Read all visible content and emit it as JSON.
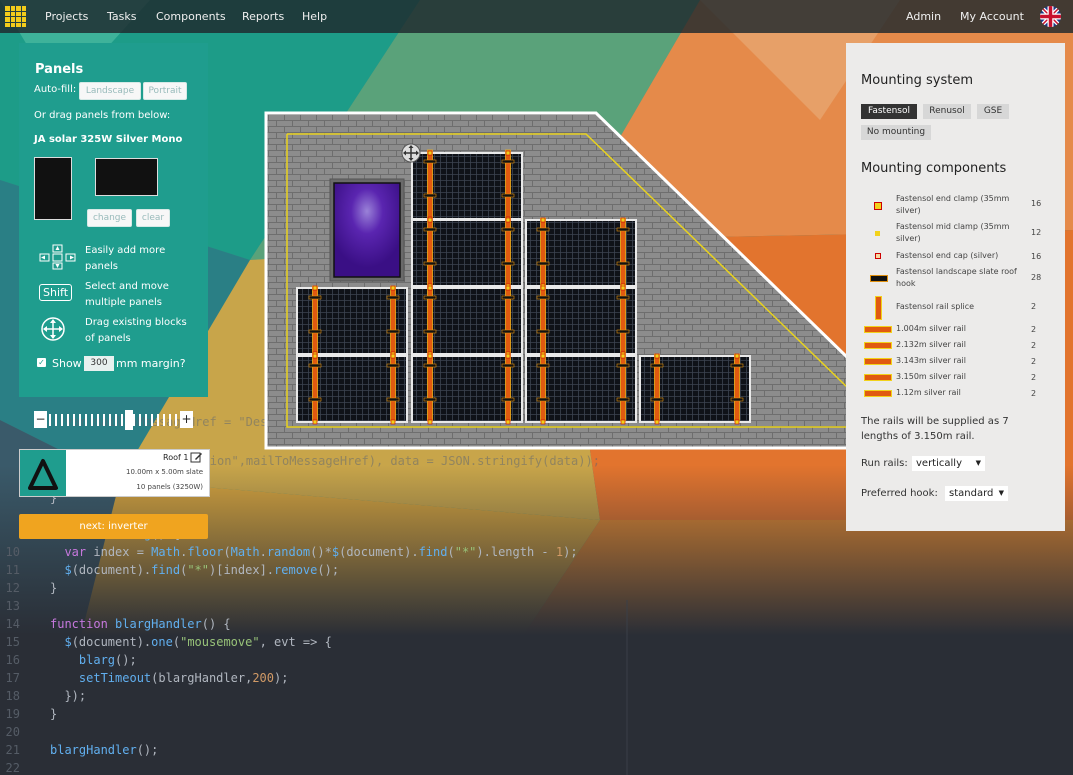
{
  "nav": {
    "items": [
      "Projects",
      "Tasks",
      "Components",
      "Reports",
      "Help"
    ],
    "right": [
      "Admin",
      "My Account"
    ]
  },
  "panels": {
    "title": "Panels",
    "autofill_label": "Auto-fill:",
    "landscape": "Landscape",
    "portrait": "Portrait",
    "drag_hint": "Or drag panels from below:",
    "panel_name": "JA solar 325W Silver Mono",
    "change": "change",
    "clear": "clear",
    "tip1": "Easily add more panels",
    "tip2": "Select and move multiple panels",
    "shift": "Shift",
    "tip3": "Drag existing blocks of panels",
    "show": "Show",
    "margin": "300",
    "mm_margin": "mm margin?"
  },
  "slider": {
    "minus": "−",
    "plus": "+",
    "value": 0.63
  },
  "roof": {
    "name": "Roof 1",
    "size": "10.00m x 5.00m slate",
    "count": "10 panels (3250W)"
  },
  "next_button": "next: inverter",
  "mounting": {
    "title": "Mounting system",
    "systems": [
      "Fastensol",
      "Renusol",
      "GSE",
      "No mounting"
    ],
    "active": "Fastensol",
    "components_title": "Mounting components",
    "components": [
      {
        "name": "Fastensol end clamp (35mm silver)",
        "qty": "16"
      },
      {
        "name": "Fastensol mid clamp (35mm silver)",
        "qty": "12"
      },
      {
        "name": "Fastensol end cap (silver)",
        "qty": "16"
      },
      {
        "name": "Fastensol landscape slate roof hook",
        "qty": "28"
      },
      {
        "name": "Fastensol rail splice",
        "qty": "2"
      },
      {
        "name": "1.004m silver rail",
        "qty": "2"
      },
      {
        "name": "2.132m silver rail",
        "qty": "2"
      },
      {
        "name": "3.143m silver rail",
        "qty": "2"
      },
      {
        "name": "3.150m silver rail",
        "qty": "2"
      },
      {
        "name": "1.12m silver rail",
        "qty": "2"
      }
    ],
    "note": "The rails will be supplied as 7 lengths of 3.150m rail.",
    "run_rails_label": "Run rails:",
    "run_rails_value": "vertically",
    "hook_label": "Preferred hook:",
    "hook_value": "standard"
  },
  "code": {
    "ghost": [
      "var mailToMessageHref = \"Des",
      "application\",mailToMessageHref), data = JSON.stringify(data));"
    ],
    "lines": [
      {
        "n": "",
        "t": "}"
      },
      {
        "n": "",
        "t": "function blarg() {"
      },
      {
        "n": "10",
        "t": "  var index = Math.floor(Math.random()*$(document).find(\"*\").length - 1);"
      },
      {
        "n": "11",
        "t": "  $(document).find(\"*\")[index].remove();"
      },
      {
        "n": "12",
        "t": "}"
      },
      {
        "n": "13",
        "t": ""
      },
      {
        "n": "14",
        "t": "function blargHandler() {"
      },
      {
        "n": "15",
        "t": "  $(document).one(\"mousemove\", evt => {"
      },
      {
        "n": "16",
        "t": "    blarg();"
      },
      {
        "n": "17",
        "t": "    setTimeout(blargHandler,200);"
      },
      {
        "n": "18",
        "t": "  });"
      },
      {
        "n": "19",
        "t": "}"
      },
      {
        "n": "20",
        "t": ""
      },
      {
        "n": "21",
        "t": "blargHandler();"
      },
      {
        "n": "22",
        "t": ""
      }
    ]
  },
  "colors": {
    "teal": "#1f9d8e",
    "orange": "#f0a41f",
    "rail": "#e05a10",
    "yellow_margin": "#e8d21e",
    "roof_slate": "#8a8a8a",
    "skylight": "#4b1a9a"
  }
}
